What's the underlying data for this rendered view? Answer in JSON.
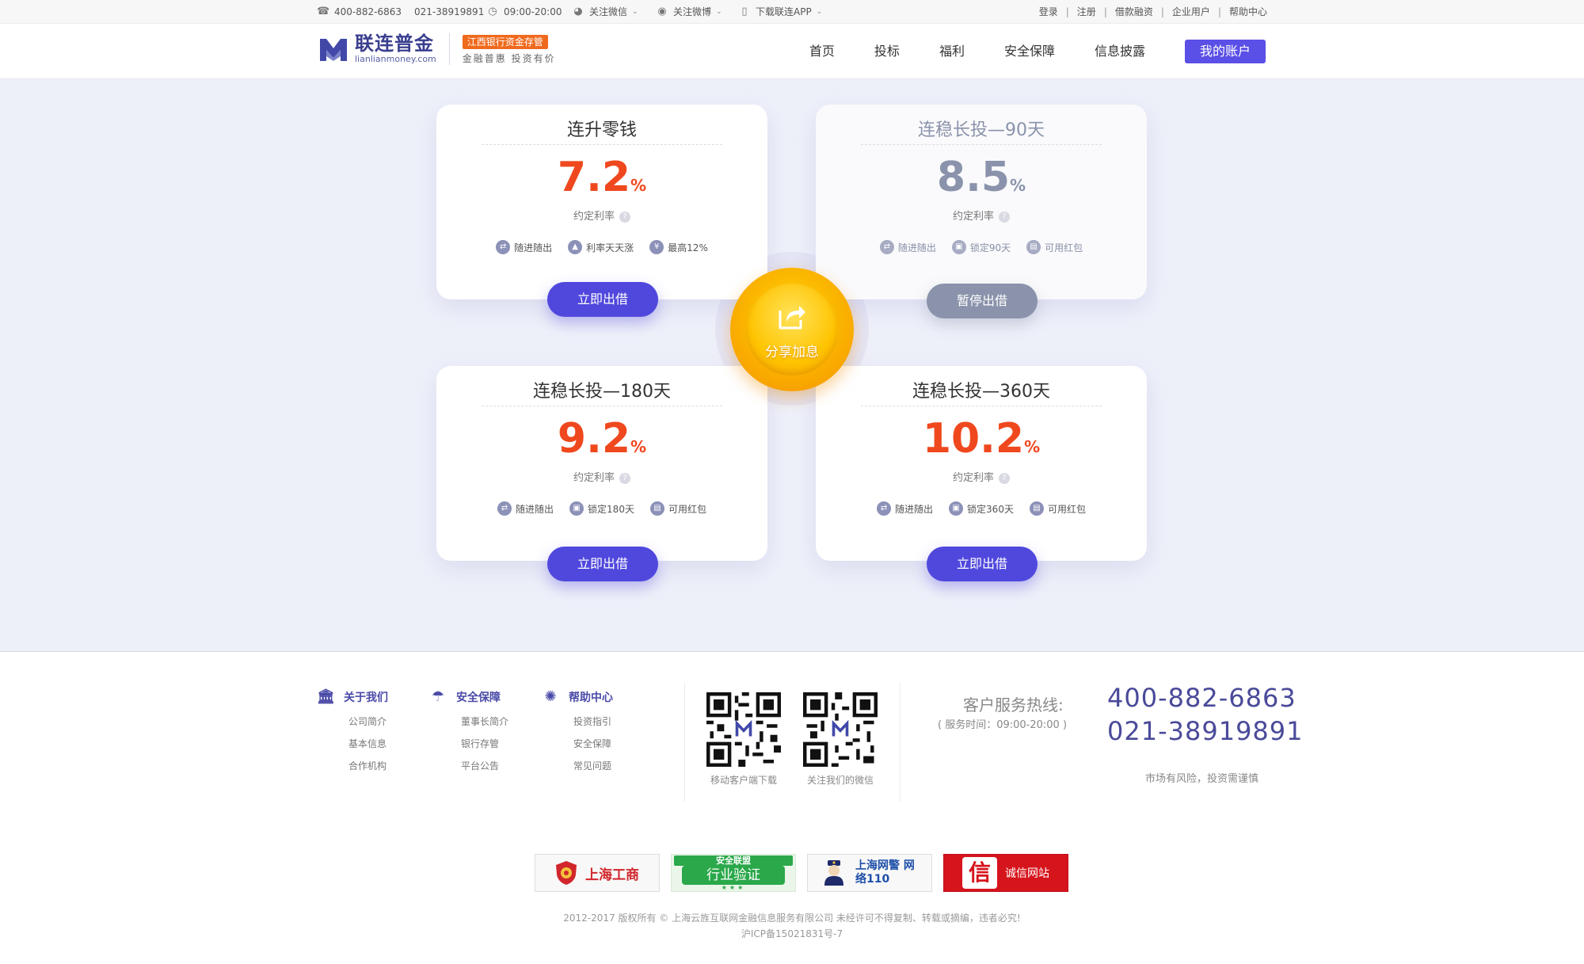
{
  "topbar": {
    "phone1": "400-882-6863",
    "phone2": "021-38919891",
    "hours": "09:00-20:00",
    "wechat": "关注微信",
    "weibo": "关注微博",
    "app": "下载联连APP",
    "links": [
      "登录",
      "注册",
      "借款融资",
      "企业用户",
      "帮助中心"
    ]
  },
  "header": {
    "logo_cn": "联连普金",
    "logo_en": "lianlianmoney.com",
    "bank_badge": "江西银行资金存管",
    "slogan": "金融普惠 投资有价",
    "nav": [
      "首页",
      "投标",
      "福利",
      "安全保障",
      "信息披露"
    ],
    "account": "我的账户"
  },
  "products": [
    {
      "title": "连升零钱",
      "rate": "7.2",
      "pct": "%",
      "rate_label": "约定利率",
      "features": [
        "随进随出",
        "利率天天涨",
        "最高12%"
      ],
      "button": "立即出借",
      "status": "active"
    },
    {
      "title": "连稳长投—90天",
      "rate": "8.5",
      "pct": "%",
      "rate_label": "约定利率",
      "features": [
        "随进随出",
        "锁定90天",
        "可用红包"
      ],
      "button": "暂停出借",
      "status": "paused"
    },
    {
      "title": "连稳长投—180天",
      "rate": "9.2",
      "pct": "%",
      "rate_label": "约定利率",
      "features": [
        "随进随出",
        "锁定180天",
        "可用红包"
      ],
      "button": "立即出借",
      "status": "active"
    },
    {
      "title": "连稳长投—360天",
      "rate": "10.2",
      "pct": "%",
      "rate_label": "约定利率",
      "features": [
        "随进随出",
        "锁定360天",
        "可用红包"
      ],
      "button": "立即出借",
      "status": "active"
    }
  ],
  "share": {
    "label": "分享加息"
  },
  "footer": {
    "columns": [
      {
        "title": "关于我们",
        "icon": "bank-icon",
        "links": [
          "公司简介",
          "基本信息",
          "合作机构"
        ]
      },
      {
        "title": "安全保障",
        "icon": "umbrella-icon",
        "links": [
          "董事长简介",
          "银行存管",
          "平台公告"
        ]
      },
      {
        "title": "帮助中心",
        "icon": "lightbulb-icon",
        "links": [
          "投资指引",
          "安全保障",
          "常见问题"
        ]
      }
    ],
    "qr": [
      {
        "caption": "移动客户端下载"
      },
      {
        "caption": "关注我们的微信"
      }
    ],
    "hotline_label": "客户服务热线:",
    "hotline_time": "( 服务时间：09:00-20:00 )",
    "hotline1": "400-882-6863",
    "hotline2": "021-38919891",
    "risk": "市场有风险，投资需谨慎",
    "badges": [
      "上海工商",
      "行业验证",
      "上海网警 网络110",
      "诚信网站"
    ],
    "badge_top": "安全联盟",
    "copyright": "2012-2017 版权所有 © 上海云旌互联网金融信息服务有限公司    未经许可不得复制、转载或摘编，违者必究!",
    "icp": "沪ICP备15021831号-7"
  },
  "colors": {
    "accent": "#5048dd",
    "rate": "#f0481e",
    "paused": "#8a93ab",
    "coin": "#ffc400"
  }
}
